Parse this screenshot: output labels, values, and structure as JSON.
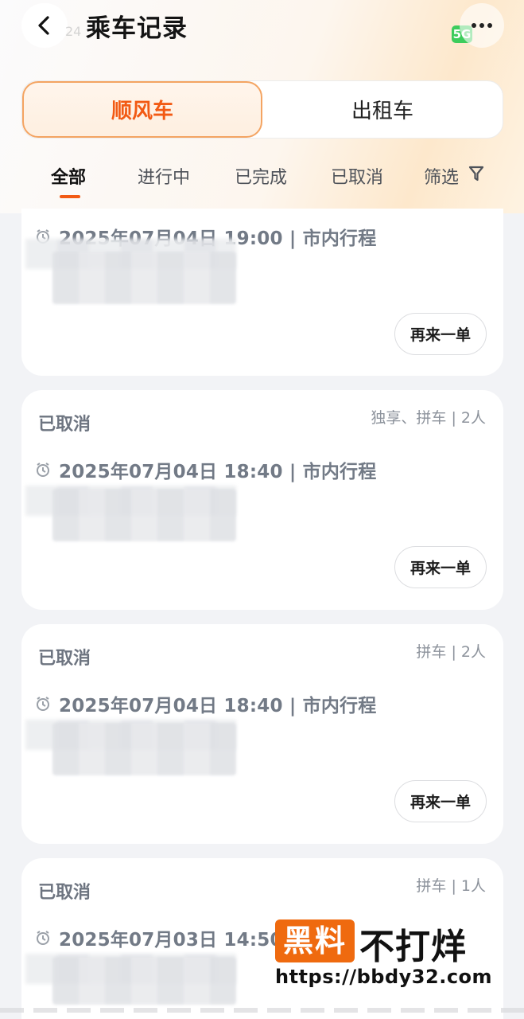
{
  "header": {
    "title": "乘车记录",
    "status_time_ghost": "24",
    "network_badge": "5G"
  },
  "tabs": {
    "ride_share": "顺风车",
    "taxi": "出租车"
  },
  "filters": {
    "all": "全部",
    "in_progress": "进行中",
    "completed": "已完成",
    "cancelled": "已取消",
    "screen": "筛选"
  },
  "orders": [
    {
      "status": "",
      "meta": "",
      "time": "2025年07月04日 19:00 | 市内行程",
      "reorder_label": "再来一单"
    },
    {
      "status": "已取消",
      "meta": "独享、拼车 | 2人",
      "time": "2025年07月04日 18:40 | 市内行程",
      "reorder_label": "再来一单"
    },
    {
      "status": "已取消",
      "meta": "拼车 | 2人",
      "time": "2025年07月04日 18:40 | 市内行程",
      "reorder_label": "再来一单"
    },
    {
      "status": "已取消",
      "meta": "拼车 | 1人",
      "time": "2025年07月03日 14:50 |",
      "reorder_label": ""
    }
  ],
  "watermark": {
    "box_text": "黑料",
    "text": "不打烊",
    "url": "https://bbdy32.com"
  },
  "colors": {
    "accent": "#f25a14",
    "accent_border": "#f4a462",
    "status_gray": "#6d7480",
    "background": "#f2f3f6"
  },
  "icons": {
    "back": "chevron-left-icon",
    "more": "more-icon",
    "filter": "funnel-icon",
    "clock": "alarm-clock-icon"
  }
}
